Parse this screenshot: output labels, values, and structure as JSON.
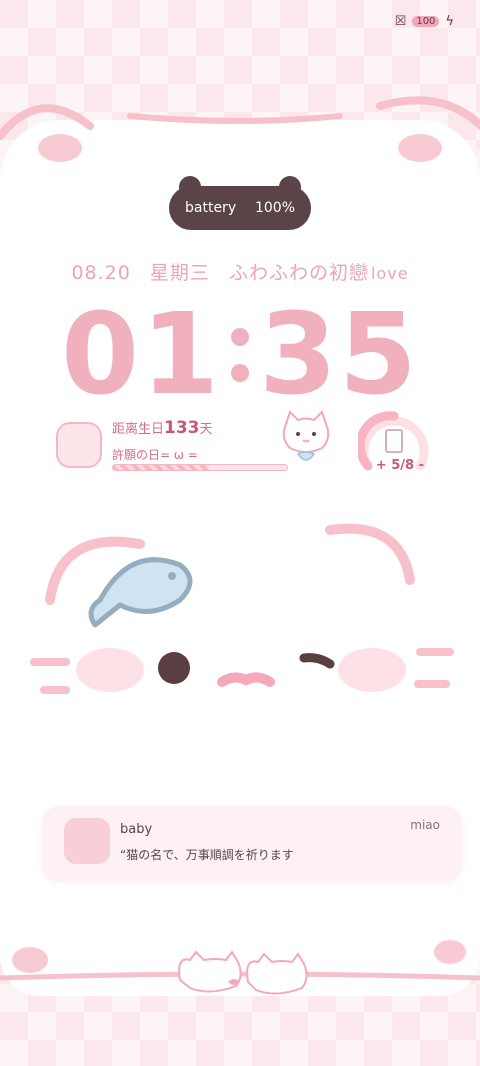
{
  "status_bar": {
    "battery_label": "100"
  },
  "battery_pill": {
    "label": "battery",
    "value": "100%"
  },
  "date_line": {
    "date": "08.20",
    "weekday": "星期三",
    "phrase": "ふわふわの初戀",
    "tail": "love"
  },
  "clock": {
    "hours": "01",
    "minutes": "35"
  },
  "birthday": {
    "prefix": "距离生日",
    "days": "133",
    "suffix": "天",
    "sub": "許願の日= ω =",
    "progress": 0.55
  },
  "counter": {
    "value": "5/8",
    "minus": "-",
    "plus": "+"
  },
  "notification": {
    "title": "baby",
    "body": "“猫の名で、万事順調を祈ります",
    "app": "miao"
  },
  "colors": {
    "accent": "#f0b0bd",
    "dark": "#5a4448",
    "fish": "#cfe3f3"
  }
}
